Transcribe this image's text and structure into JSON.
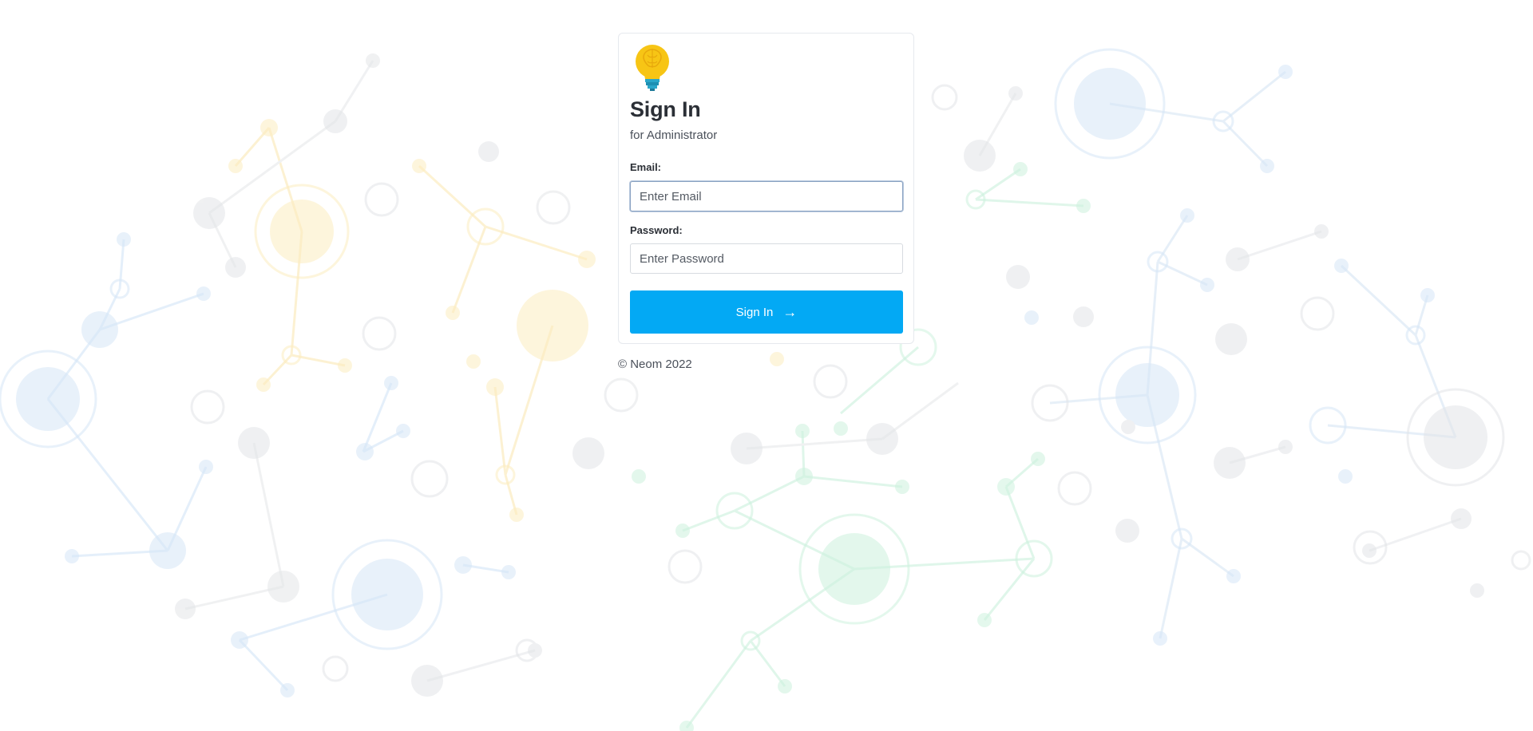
{
  "login": {
    "title": "Sign In",
    "subtitle": "for Administrator",
    "email_label": "Email:",
    "email_placeholder": "Enter Email",
    "email_value": "",
    "password_label": "Password:",
    "password_placeholder": "Enter Password",
    "password_value": "",
    "submit_label": "Sign In",
    "submit_icon": "arrow-right-icon"
  },
  "logo": {
    "icon": "lightbulb-brain-icon"
  },
  "footer": {
    "copyright": "© Neom 2022"
  },
  "theme": {
    "accent": "#03a9f4",
    "background_network_colors": [
      "#dbe9f8",
      "#fdf0c8",
      "#d3f4e4",
      "#e6e8eb"
    ]
  }
}
